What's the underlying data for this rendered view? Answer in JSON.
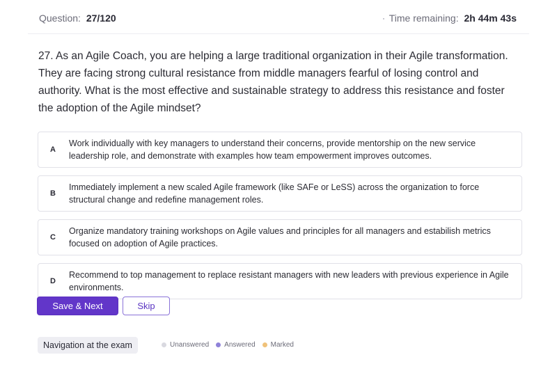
{
  "header": {
    "question_label": "Question:",
    "question_value": "27/120",
    "time_label": "Time remaining:",
    "time_value": "2h 44m 43s"
  },
  "question": {
    "text": "27. As an Agile Coach, you are helping a large traditional organization in their Agile transformation. They are facing strong cultural resistance from middle managers fearful of losing control and authority. What is the most effective and sustainable strategy to address this resistance and foster the adoption of the Agile mindset?"
  },
  "options": [
    {
      "letter": "A",
      "text": "Work individually with key managers to understand their concerns, provide mentorship on the new service leadership role, and demonstrate with examples how team empowerment improves outcomes."
    },
    {
      "letter": "B",
      "text": "Immediately implement a new scaled Agile framework (like SAFe or LeSS) across the organization to force structural change and redefine management roles."
    },
    {
      "letter": "C",
      "text": "Organize mandatory training workshops on Agile values and principles for all managers and estabilish metrics focused on adoption of Agile practices."
    },
    {
      "letter": "D",
      "text": "Recommend to top management to replace resistant managers with new leaders with previous experience in Agile environments."
    }
  ],
  "actions": {
    "save_next_label": "Save & Next",
    "skip_label": "Skip"
  },
  "navigation": {
    "label": "Navigation at the exam",
    "legend": [
      {
        "label": "Unanswered",
        "color": "#d9d9e0"
      },
      {
        "label": "Answered",
        "color": "#8f82d9"
      },
      {
        "label": "Marked",
        "color": "#f0c27a"
      }
    ]
  }
}
